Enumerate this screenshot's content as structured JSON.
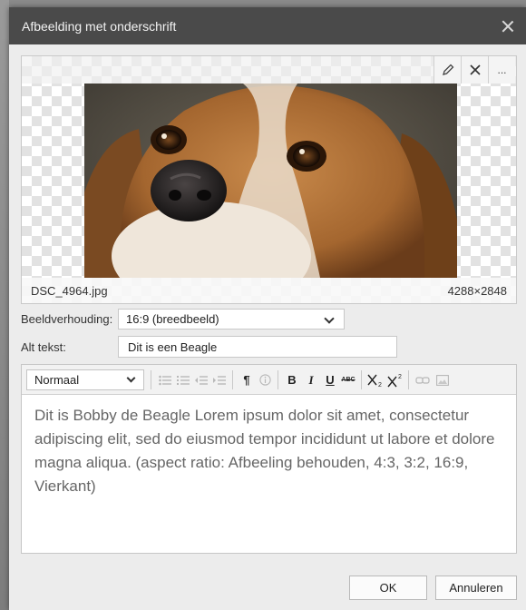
{
  "dialog": {
    "title": "Afbeelding met onderschrift"
  },
  "image": {
    "filename": "DSC_4964.jpg",
    "dimensions": "4288×2848",
    "toolbar_icons": [
      "pencil-icon",
      "close-icon",
      "more-icon"
    ],
    "more_label": "..."
  },
  "form": {
    "aspect_label": "Beeldverhouding:",
    "aspect_value": "16:9 (breedbeeld)",
    "alt_label": "Alt tekst:",
    "alt_value": "Dit is een Beagle"
  },
  "editor": {
    "format_value": "Normaal",
    "paragraph_glyph": "¶",
    "bold": "B",
    "italic": "I",
    "underline": "U",
    "strike": "ABC",
    "content": "Dit is Bobby de Beagle Lorem ipsum dolor sit amet, consectetur adipiscing elit, sed do eiusmod tempor incididunt ut labore et dolore magna aliqua. (aspect ratio: Afbeeling behouden, 4:3, 3:2, 16:9, Vierkant)"
  },
  "buttons": {
    "ok": "OK",
    "cancel": "Annuleren"
  }
}
